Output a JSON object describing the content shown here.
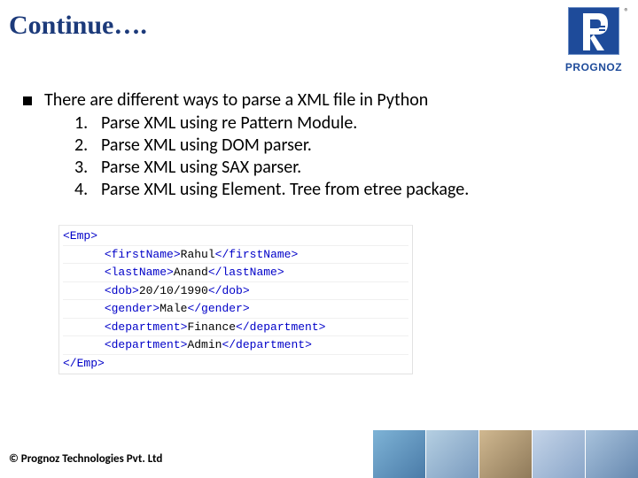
{
  "title": "Continue….",
  "logo": {
    "name": "PROGNOZ",
    "reg": "®"
  },
  "content": {
    "intro": "There are different ways to parse a XML file in Python",
    "items": [
      {
        "num": "1.",
        "text": "Parse XML using re Pattern Module."
      },
      {
        "num": "2.",
        "text": "Parse XML using DOM parser."
      },
      {
        "num": "3.",
        "text": "Parse XML using SAX parser."
      },
      {
        "num": "4.",
        "text": "Parse XML using Element. Tree from etree package."
      }
    ]
  },
  "code": {
    "l0a": "<Emp>",
    "l1a": "<firstName>",
    "l1b": "Rahul",
    "l1c": "</firstName>",
    "l2a": "<lastName>",
    "l2b": "Anand",
    "l2c": "</lastName>",
    "l3a": "<dob>",
    "l3b": "20/10/1990",
    "l3c": "</dob>",
    "l4a": "<gender>",
    "l4b": "Male",
    "l4c": "</gender>",
    "l5a": "<department>",
    "l5b": "Finance",
    "l5c": "</department>",
    "l6a": "<department>",
    "l6b": "Admin",
    "l6c": "</department>",
    "l7a": "</Emp>"
  },
  "footer": "© Prognoz Technologies Pvt. Ltd"
}
